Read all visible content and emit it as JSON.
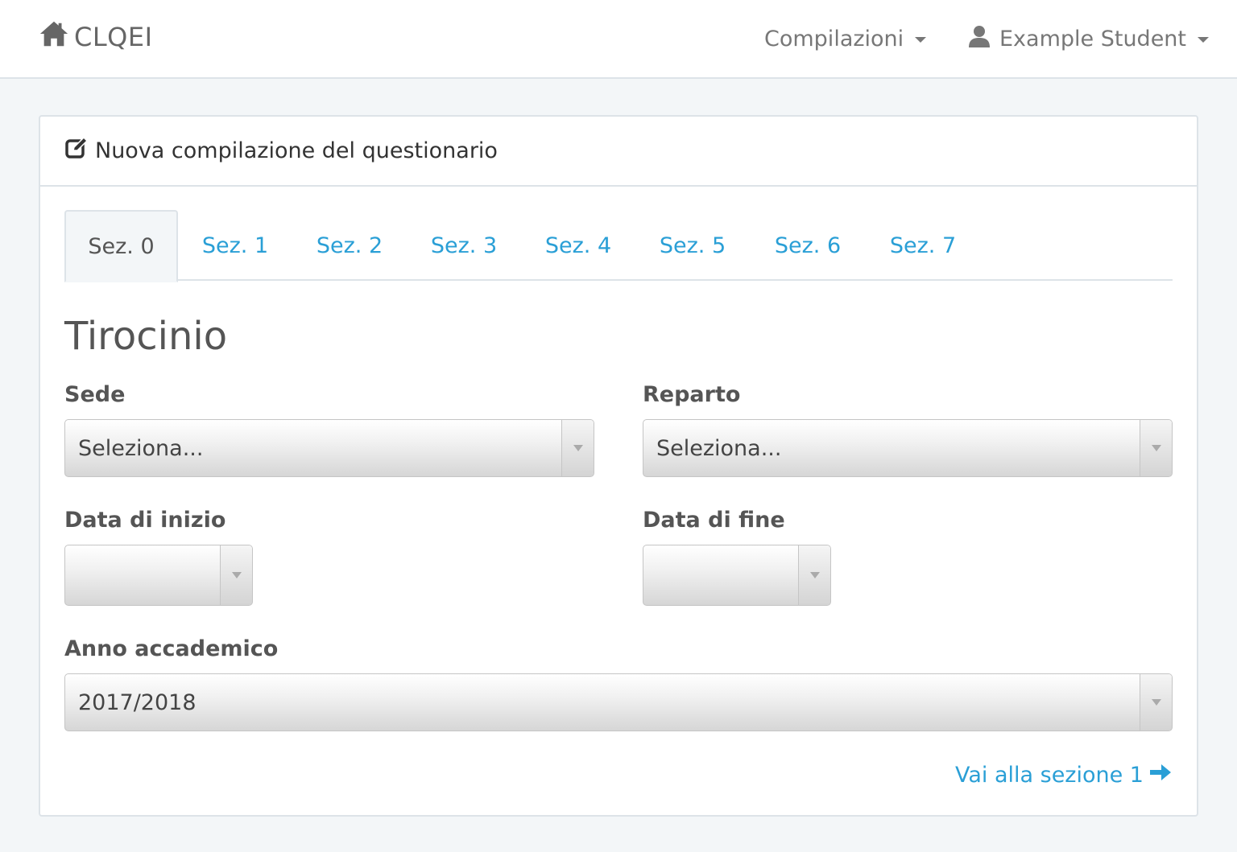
{
  "navbar": {
    "brand": "CLQEI",
    "menu_label": "Compilazioni",
    "user_label": "Example Student"
  },
  "panel": {
    "heading": "Nuova compilazione del questionario"
  },
  "tabs": [
    {
      "label": "Sez. 0",
      "active": true
    },
    {
      "label": "Sez. 1",
      "active": false
    },
    {
      "label": "Sez. 2",
      "active": false
    },
    {
      "label": "Sez. 3",
      "active": false
    },
    {
      "label": "Sez. 4",
      "active": false
    },
    {
      "label": "Sez. 5",
      "active": false
    },
    {
      "label": "Sez. 6",
      "active": false
    },
    {
      "label": "Sez. 7",
      "active": false
    }
  ],
  "form": {
    "title": "Tirocinio",
    "sede": {
      "label": "Sede",
      "value": "Seleziona..."
    },
    "reparto": {
      "label": "Reparto",
      "value": "Seleziona..."
    },
    "data_inizio": {
      "label": "Data di inizio",
      "value": ""
    },
    "data_fine": {
      "label": "Data di fine",
      "value": ""
    },
    "anno": {
      "label": "Anno accademico",
      "value": "2017/2018"
    }
  },
  "next": {
    "label": "Vai alla sezione 1"
  },
  "colors": {
    "accent": "#2a9fd6",
    "background": "#f3f6f8",
    "border": "#dde3e8"
  }
}
